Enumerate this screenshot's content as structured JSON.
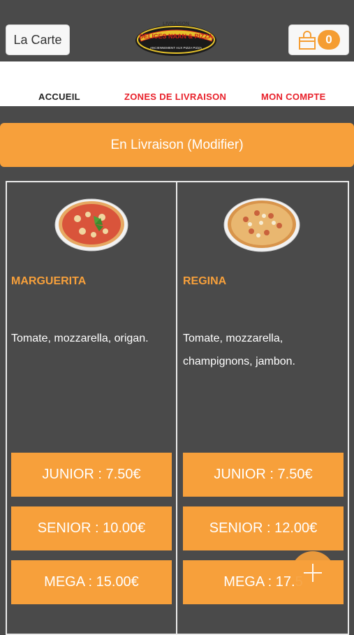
{
  "header": {
    "menu_label": "La Carte",
    "logo_top_text": "LIVRAISON",
    "logo_main_text": "DELICES NAAN & PIZZA",
    "logo_sub_text": "ANCIENNEMENT AUX PIZZA PIZZA",
    "cart_count": "0",
    "cart_icon": "shopping-bag-icon"
  },
  "nav": {
    "items": [
      {
        "label": "ACCUEIL",
        "color": "#222222"
      },
      {
        "label": "ZONES DE LIVRAISON",
        "color": "#e8202a"
      },
      {
        "label": "MON COMPTE",
        "color": "#e8202a"
      }
    ]
  },
  "delivery": {
    "label": "En Livraison (Modifier)"
  },
  "products": [
    {
      "name": "MARGUERITA",
      "description": "Tomate, mozzarella, origan.",
      "prices": [
        "JUNIOR : 7.50€",
        "SENIOR : 10.00€",
        "MEGA : 15.00€"
      ]
    },
    {
      "name": "REGINA",
      "description": "Tomate, mozzarella, champignons, jambon.",
      "prices": [
        "JUNIOR : 7.50€",
        "SENIOR : 12.00€",
        "MEGA : 17.5"
      ]
    }
  ],
  "fab": {
    "icon": "plus-icon"
  },
  "colors": {
    "accent": "#f7a03b",
    "background": "#4a4a4a",
    "nav_red": "#e8202a"
  }
}
